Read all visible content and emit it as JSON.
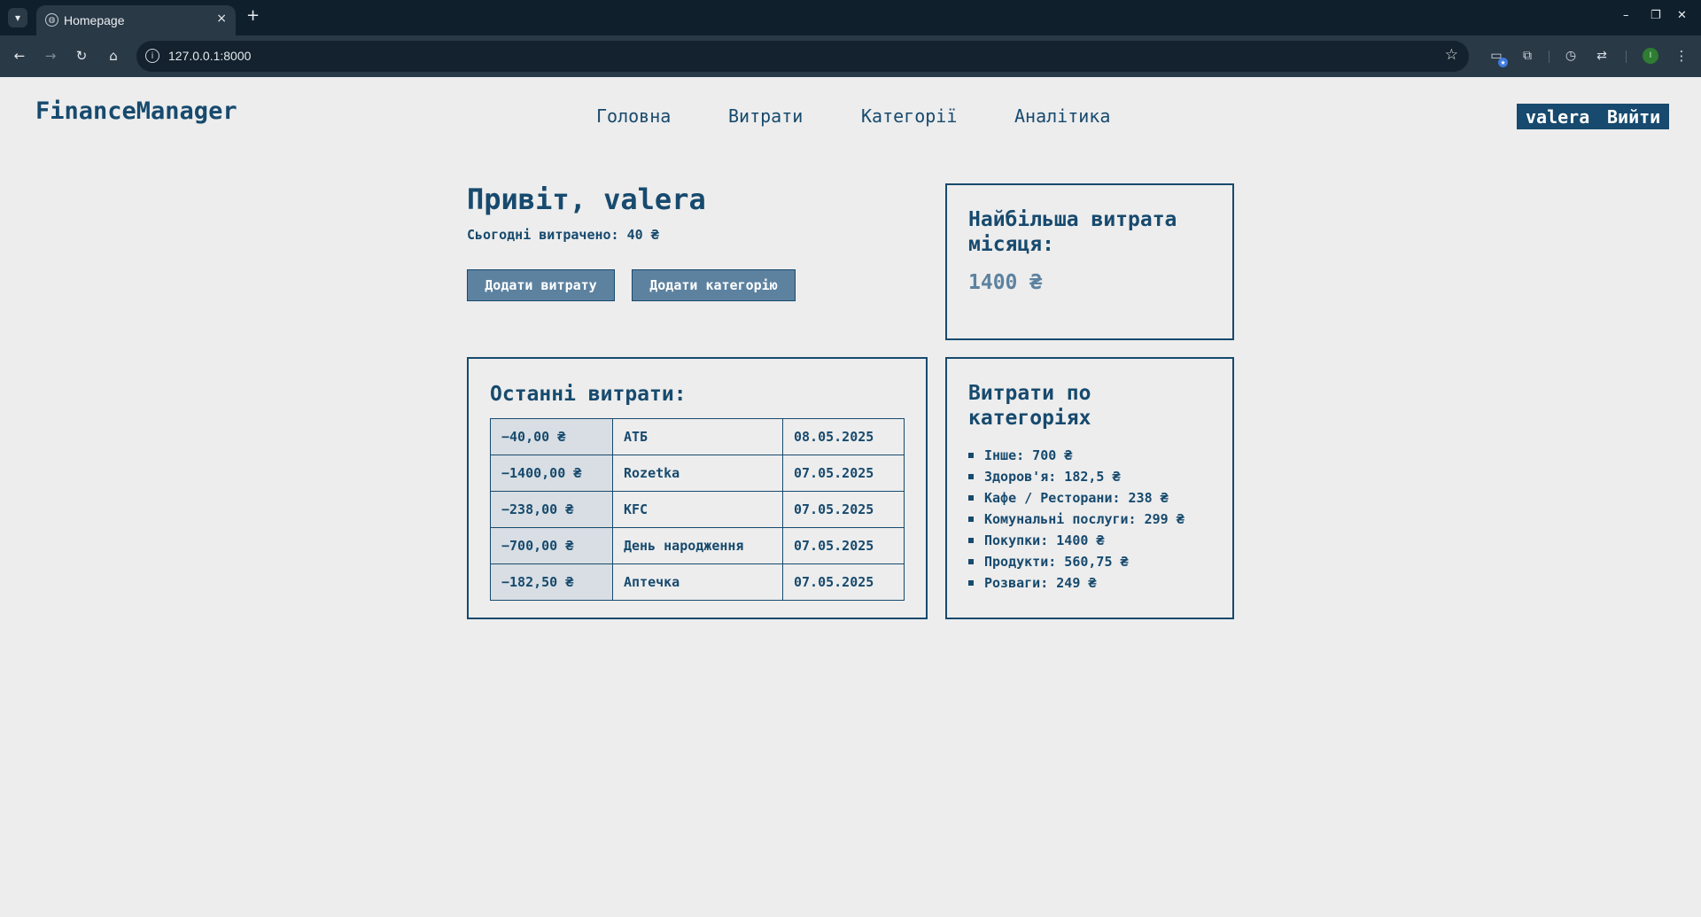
{
  "browser": {
    "tab_title": "Homepage",
    "url": "127.0.0.1:8000",
    "tab_close_glyph": "×",
    "new_tab_glyph": "+",
    "back_glyph": "←",
    "forward_glyph": "→",
    "reload_glyph": "↻",
    "home_glyph": "⌂",
    "star_glyph": "☆",
    "menu_glyph": "⋮",
    "profile_initial": "I"
  },
  "site": {
    "brand": "FinanceManager",
    "nav": [
      "Головна",
      "Витрати",
      "Категорії",
      "Аналітика"
    ],
    "username": "valera",
    "logout_label": "Вийти"
  },
  "hero": {
    "greeting": "Привіт, valera",
    "spent_today": "Сьогодні витрачено: 40 ₴",
    "add_expense_label": "Додати витрату",
    "add_category_label": "Додати категорію"
  },
  "biggest": {
    "title": "Найбільша витрата місяця:",
    "value": "1400 ₴"
  },
  "recent": {
    "title": "Останні витрати:",
    "rows": [
      {
        "amount": "−40,00 ₴",
        "name": "АТБ",
        "date": "08.05.2025"
      },
      {
        "amount": "−1400,00 ₴",
        "name": "Rozetka",
        "date": "07.05.2025"
      },
      {
        "amount": "−238,00 ₴",
        "name": "KFC",
        "date": "07.05.2025"
      },
      {
        "amount": "−700,00 ₴",
        "name": "День народження",
        "date": "07.05.2025"
      },
      {
        "amount": "−182,50 ₴",
        "name": "Аптечка",
        "date": "07.05.2025"
      }
    ]
  },
  "categories": {
    "title": "Витрати по категоріях",
    "items": [
      "Інше: 700 ₴",
      "Здоров'я: 182,5 ₴",
      "Кафе / Ресторани: 238 ₴",
      "Комунальні послуги: 299 ₴",
      "Покупки: 1400 ₴",
      "Продукти: 560,75 ₴",
      "Розваги: 249 ₴"
    ]
  }
}
